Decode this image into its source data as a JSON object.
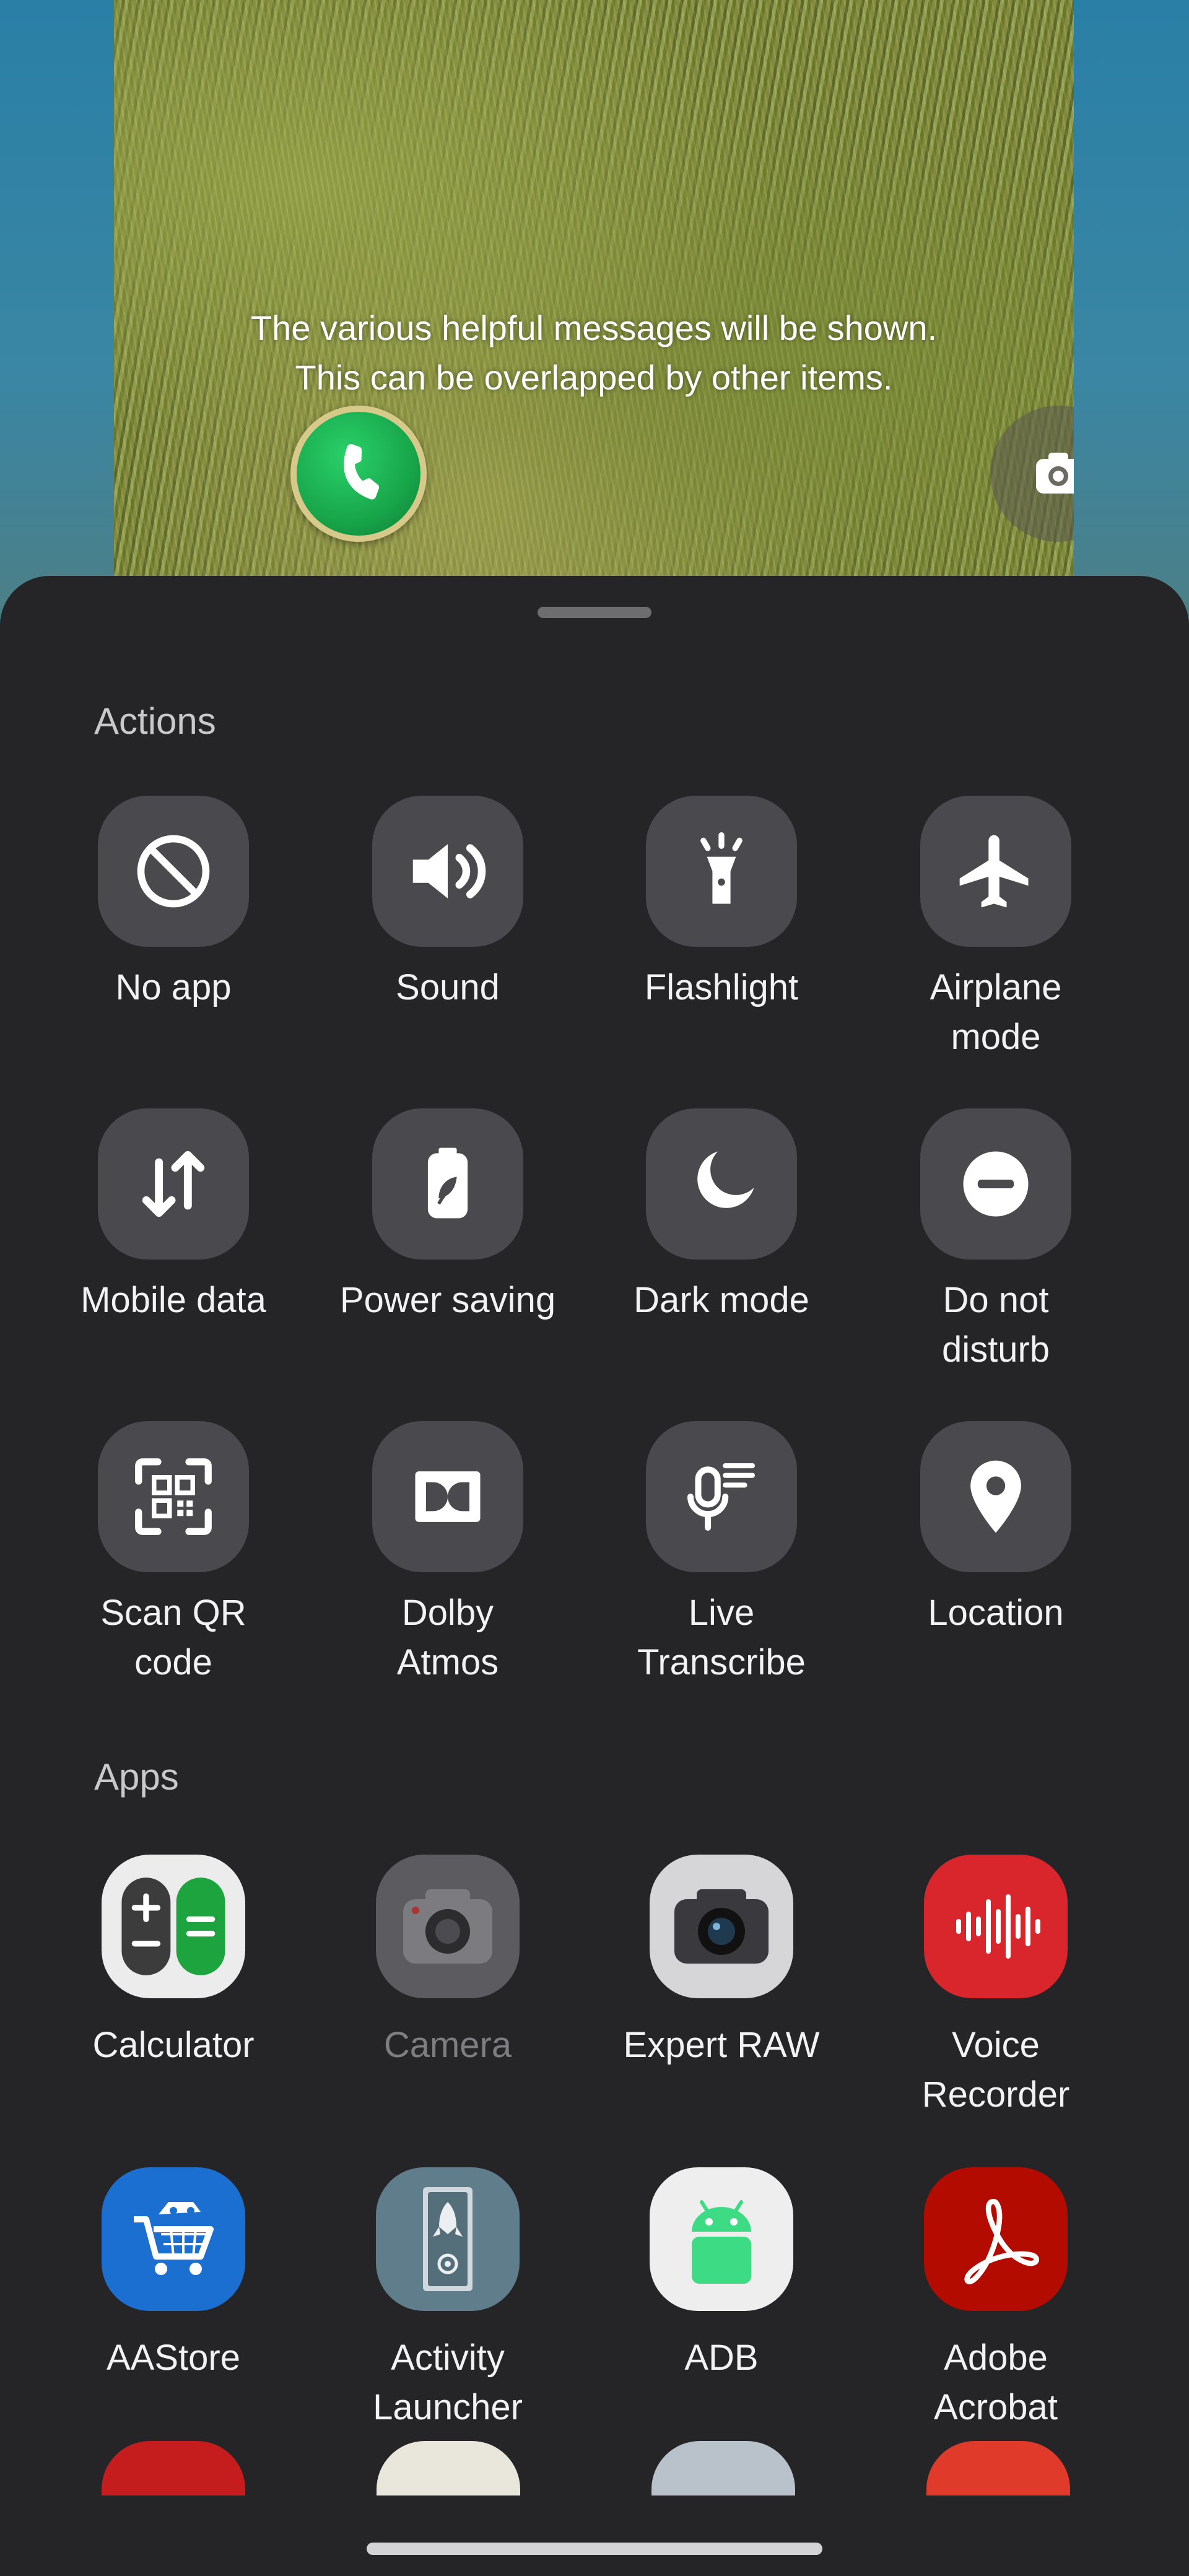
{
  "lock_preview": {
    "help_message_line1": "The various helpful messages will be shown.",
    "help_message_line2": "This can be overlapped by other items.",
    "left_shortcut_icon": "phone-icon",
    "right_shortcut_icon": "camera-icon"
  },
  "sheet": {
    "actions_title": "Actions",
    "actions": [
      {
        "label": "No app",
        "icon": "no-app-icon"
      },
      {
        "label": "Sound",
        "icon": "sound-icon"
      },
      {
        "label": "Flashlight",
        "icon": "flashlight-icon"
      },
      {
        "label": "Airplane mode",
        "icon": "airplane-icon"
      },
      {
        "label": "Mobile data",
        "icon": "mobile-data-icon"
      },
      {
        "label": "Power saving",
        "icon": "power-saving-icon"
      },
      {
        "label": "Dark mode",
        "icon": "dark-mode-icon"
      },
      {
        "label": "Do not disturb",
        "icon": "do-not-disturb-icon"
      },
      {
        "label": "Scan QR code",
        "icon": "qr-scan-icon"
      },
      {
        "label": "Dolby Atmos",
        "icon": "dolby-icon"
      },
      {
        "label": "Live Transcribe",
        "icon": "live-transcribe-icon"
      },
      {
        "label": "Location",
        "icon": "location-icon"
      }
    ],
    "apps_title": "Apps",
    "apps": [
      {
        "label": "Calculator",
        "icon": "calculator-icon"
      },
      {
        "label": "Camera",
        "icon": "camera-app-icon",
        "disabled": true
      },
      {
        "label": "Expert RAW",
        "icon": "expert-raw-icon"
      },
      {
        "label": "Voice Recorder",
        "icon": "voice-recorder-icon"
      },
      {
        "label": "AAStore",
        "icon": "aastore-icon"
      },
      {
        "label": "Activity Launcher",
        "icon": "activity-launcher-icon"
      },
      {
        "label": "ADB",
        "icon": "adb-icon"
      },
      {
        "label": "Adobe Acrobat",
        "icon": "adobe-acrobat-icon"
      }
    ]
  },
  "colors": {
    "sheet_bg": "#252528",
    "tile_bg": "#4a4a4e",
    "accent_green": "#18a64a",
    "voice_red": "#d8262c",
    "adobe_red": "#b30b00",
    "aastore_blue": "#1b6fd1"
  }
}
